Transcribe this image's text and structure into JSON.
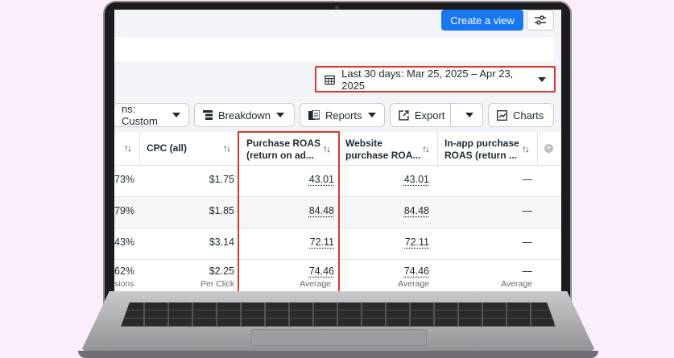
{
  "toolbar": {
    "create_view_label": "Create a view",
    "date_range_label": "Last 30 days: Mar 25, 2025 – Apr 23, 2025",
    "columns_label": "ns: Custom",
    "breakdown_label": "Breakdown",
    "reports_label": "Reports",
    "export_label": "Export",
    "charts_label": "Charts"
  },
  "table": {
    "headers": {
      "first_partial": "",
      "cpc": "CPC (all)",
      "purchase_roas_line1": "Purchase ROAS",
      "purchase_roas_line2": "(return on ad...",
      "website_roas_line1": "Website",
      "website_roas_line2": "purchase ROA...",
      "inapp_roas_line1": "In-app purchase",
      "inapp_roas_line2": "ROAS (return ..."
    },
    "rows": [
      {
        "first": "73%",
        "cpc": "$1.75",
        "purchase_roas": "43.01",
        "website_roas": "43.01",
        "inapp_roas": "—"
      },
      {
        "first": "79%",
        "cpc": "$1.85",
        "purchase_roas": "84.48",
        "website_roas": "84.48",
        "inapp_roas": "—"
      },
      {
        "first": "43%",
        "cpc": "$3.14",
        "purchase_roas": "72.11",
        "website_roas": "72.11",
        "inapp_roas": "—"
      }
    ],
    "summary": {
      "first": "62%",
      "first_sub": "sions",
      "cpc": "$2.25",
      "cpc_sub": "Per Click",
      "purchase_roas": "74.46",
      "purchase_roas_sub": "Average",
      "website_roas": "74.46",
      "website_roas_sub": "Average",
      "inapp_roas": "—",
      "inapp_roas_sub": "Average"
    },
    "sort_glyph": "↑↓"
  },
  "colors": {
    "accent": "#1877f2",
    "highlight": "#e0372d",
    "background": "#fbeefb"
  }
}
